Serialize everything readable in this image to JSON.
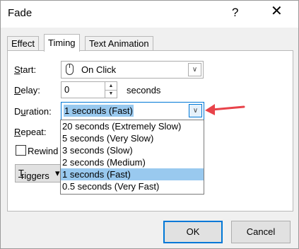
{
  "window": {
    "title": "Fade",
    "help_glyph": "?",
    "close_glyph": "✕"
  },
  "tabs": [
    {
      "label": "Effect",
      "active": false
    },
    {
      "label": "Timing",
      "active": true
    },
    {
      "label": "Text Animation",
      "active": false
    }
  ],
  "start": {
    "label_u": "S",
    "label_rest": "tart:",
    "value": "On Click"
  },
  "delay": {
    "label_u": "D",
    "label_rest": "elay:",
    "value": "0",
    "unit": "seconds"
  },
  "duration": {
    "label_pre": "D",
    "label_u": "u",
    "label_rest": "ration:",
    "value": "1 seconds (Fast)",
    "options": [
      {
        "label": "20 seconds (Extremely Slow)",
        "selected": false
      },
      {
        "label": "5 seconds (Very Slow)",
        "selected": false
      },
      {
        "label": "3 seconds (Slow)",
        "selected": false
      },
      {
        "label": "2 seconds (Medium)",
        "selected": false
      },
      {
        "label": "1 seconds (Fast)",
        "selected": true
      },
      {
        "label": "0.5 seconds (Very Fast)",
        "selected": false
      }
    ]
  },
  "repeat": {
    "label_u": "R",
    "label_rest": "epeat:"
  },
  "rewind": {
    "label_pre": "Rewind"
  },
  "triggers": {
    "label_u": "T",
    "label_rest": "riggers"
  },
  "buttons": {
    "ok": "OK",
    "cancel": "Cancel"
  },
  "colors": {
    "accent": "#0078d7",
    "highlight": "#99c9ef",
    "callout": "#e8434a"
  }
}
